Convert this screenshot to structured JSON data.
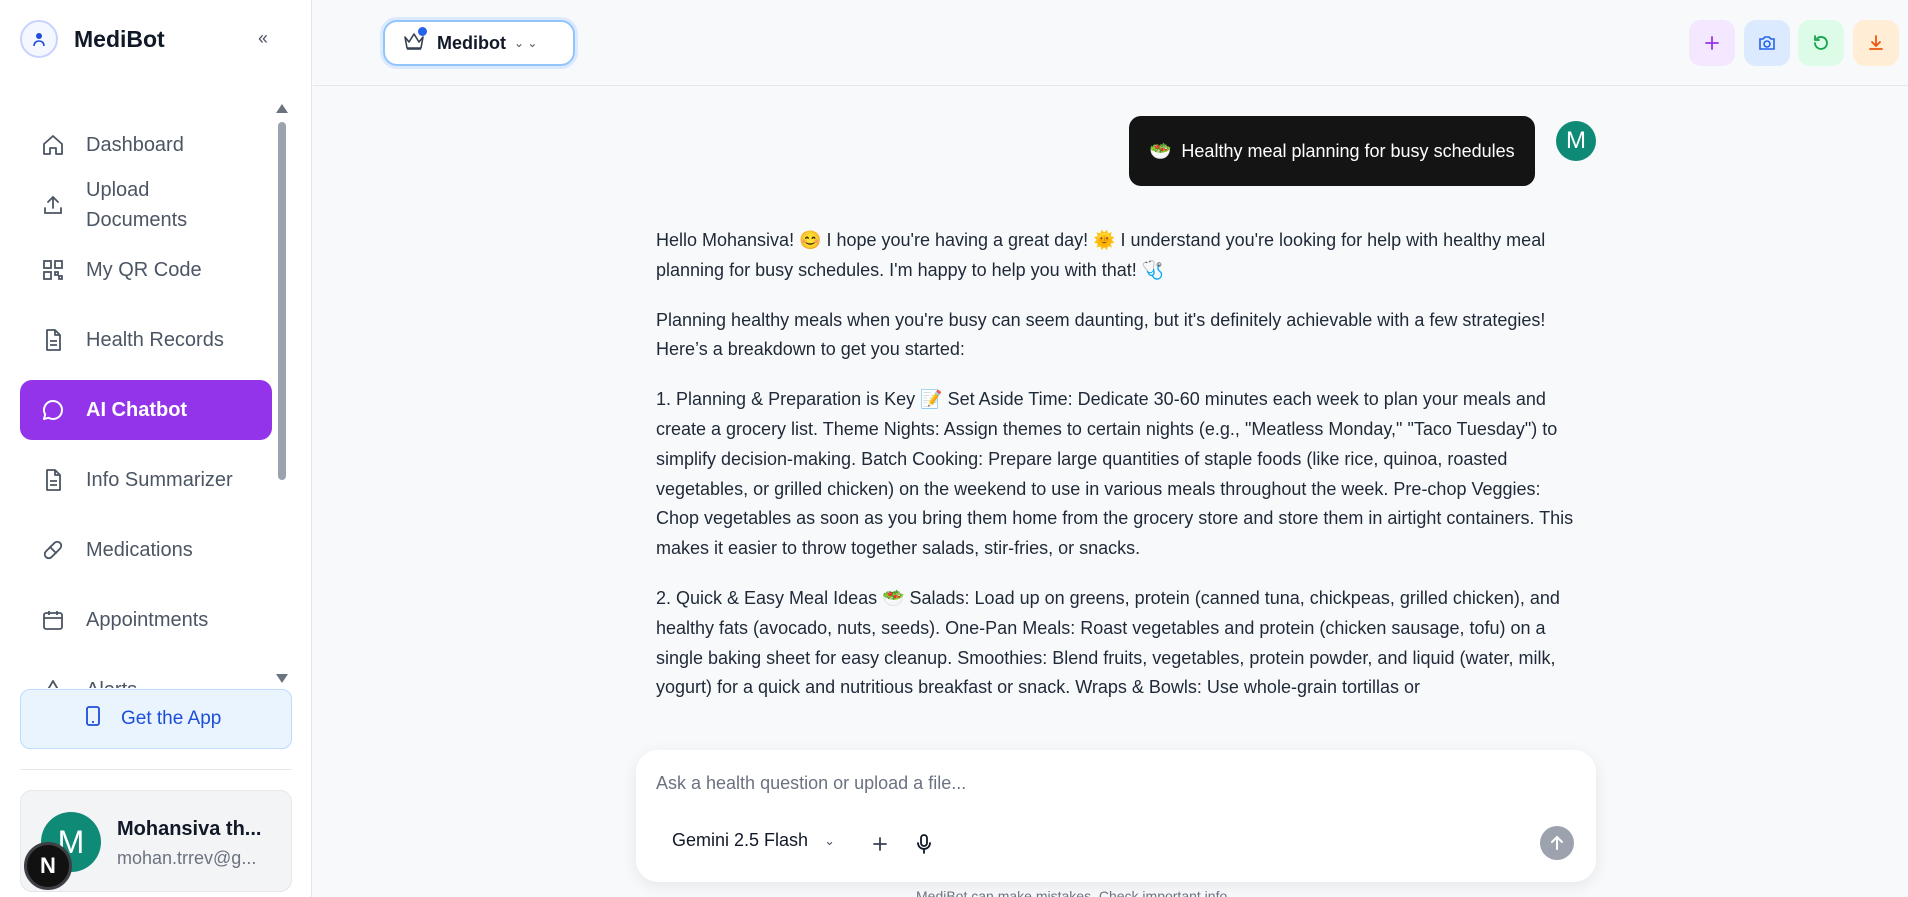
{
  "app": {
    "title": "MediBot"
  },
  "sidebar": {
    "collapse_label": "‹‹",
    "items": [
      {
        "label": "Dashboard",
        "icon": "home-icon"
      },
      {
        "label": "Upload Documents",
        "icon": "upload-icon"
      },
      {
        "label": "My QR Code",
        "icon": "qr-code-icon"
      },
      {
        "label": "Health Records",
        "icon": "document-icon"
      },
      {
        "label": "AI Chatbot",
        "icon": "chat-bubble-icon",
        "active": true
      },
      {
        "label": "Info Summarizer",
        "icon": "document-icon"
      },
      {
        "label": "Medications",
        "icon": "pill-icon"
      },
      {
        "label": "Appointments",
        "icon": "calendar-icon"
      },
      {
        "label": "Alerts",
        "icon": "alert-icon"
      }
    ],
    "get_app": "Get the App",
    "user": {
      "initial": "M",
      "name": "Mohansiva th...",
      "email": "mohan.trrev@g..."
    },
    "next_badge": "N"
  },
  "header": {
    "model_switch": "Medibot"
  },
  "chat": {
    "user_initial": "M",
    "user_message": {
      "emoji": "🥗",
      "text": "Healthy meal planning for busy schedules"
    },
    "bot_paragraphs": [
      "Hello Mohansiva! 😊 I hope you're having a great day! 🌞 I understand you're looking for help with healthy meal planning for busy schedules. I'm happy to help you with that! 🩺",
      "Planning healthy meals when you're busy can seem daunting, but it's definitely achievable with a few strategies! Here’s a breakdown to get you started:",
      "1. Planning & Preparation is Key 📝 Set Aside Time: Dedicate 30-60 minutes each week to plan your meals and create a grocery list. Theme Nights: Assign themes to certain nights (e.g., \"Meatless Monday,\" \"Taco Tuesday\") to simplify decision-making. Batch Cooking: Prepare large quantities of staple foods (like rice, quinoa, roasted vegetables, or grilled chicken) on the weekend to use in various meals throughout the week. Pre-chop Veggies: Chop vegetables as soon as you bring them home from the grocery store and store them in airtight containers. This makes it easier to throw together salads, stir-fries, or snacks.",
      "2. Quick & Easy Meal Ideas 🥗 Salads: Load up on greens, protein (canned tuna, chickpeas, grilled chicken), and healthy fats (avocado, nuts, seeds). One-Pan Meals: Roast vegetables and protein (chicken sausage, tofu) on a single baking sheet for easy cleanup. Smoothies: Blend fruits, vegetables, protein powder, and liquid (water, milk, yogurt) for a quick and nutritious breakfast or snack. Wraps & Bowls: Use whole-grain tortillas or"
    ]
  },
  "composer": {
    "placeholder": "Ask a health question or upload a file...",
    "model": "Gemini 2.5 Flash",
    "disclaimer": "MediBot can make mistakes. Check important info."
  }
}
